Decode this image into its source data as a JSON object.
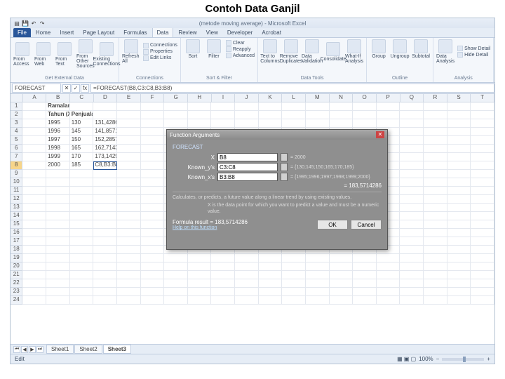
{
  "slide_title": "Contoh Data Ganjil",
  "window_title": "(metode moving average) - Microsoft Excel",
  "qat": {
    "save": "💾",
    "undo": "↶",
    "redo": "↷"
  },
  "tabs": [
    "File",
    "Home",
    "Insert",
    "Page Layout",
    "Formulas",
    "Data",
    "Review",
    "View",
    "Developer",
    "Acrobat"
  ],
  "active_tab": "Data",
  "ribbon": {
    "g1": {
      "items": [
        "From Access",
        "From Web",
        "From Text",
        "From Other Sources",
        "Existing Connections"
      ],
      "label": "Get External Data"
    },
    "g2": {
      "items": [
        "Refresh All"
      ],
      "sub": [
        "Connections",
        "Properties",
        "Edit Links"
      ],
      "label": "Connections"
    },
    "g3": {
      "items": [
        "Sort",
        "Filter"
      ],
      "sub": [
        "Clear",
        "Reapply",
        "Advanced"
      ],
      "label": "Sort & Filter"
    },
    "g4": {
      "items": [
        "Text to Columns",
        "Remove Duplicates",
        "Data Validation",
        "Consolidate",
        "What-If Analysis"
      ],
      "label": "Data Tools"
    },
    "g5": {
      "items": [
        "Group",
        "Ungroup",
        "Subtotal"
      ],
      "label": "Outline"
    },
    "g6": {
      "items": [
        "Data Analysis"
      ],
      "sub": [
        "Show Detail",
        "Hide Detail"
      ],
      "label": "Analysis"
    }
  },
  "namebox": "FORECAST",
  "fx": {
    "cancel": "✕",
    "ok": "✓",
    "fx": "fx"
  },
  "formula": "=FORECAST(B8,C3:C8,B3:B8)",
  "columns": [
    "A",
    "B",
    "C",
    "D",
    "E",
    "F",
    "G",
    "H",
    "I",
    "J",
    "K",
    "L",
    "M",
    "N",
    "O",
    "P",
    "Q",
    "R",
    "S",
    "T"
  ],
  "rows": [
    {
      "n": "1",
      "cells": [
        "",
        "Ramalan Penjualan Metode Least Square Data Genap",
        "",
        "",
        "",
        "",
        "",
        "",
        "",
        "",
        "",
        "",
        "",
        "",
        "",
        "",
        "",
        "",
        "",
        ""
      ]
    },
    {
      "n": "2",
      "cells": [
        "",
        "Tahun (X)",
        "Penjualan (Y)",
        "",
        "",
        "",
        "",
        "",
        "",
        "",
        "",
        "",
        "",
        "",
        "",
        "",
        "",
        "",
        "",
        ""
      ]
    },
    {
      "n": "3",
      "cells": [
        "",
        "1995",
        "130",
        "131,4286",
        "",
        "",
        "",
        "",
        "",
        "",
        "",
        "",
        "",
        "",
        "",
        "",
        "",
        "",
        "",
        ""
      ]
    },
    {
      "n": "4",
      "cells": [
        "",
        "1996",
        "145",
        "141,8571",
        "",
        "",
        "",
        "",
        "",
        "",
        "",
        "",
        "",
        "",
        "",
        "",
        "",
        "",
        "",
        ""
      ]
    },
    {
      "n": "5",
      "cells": [
        "",
        "1997",
        "150",
        "152,2857",
        "",
        "",
        "",
        "",
        "",
        "",
        "",
        "",
        "",
        "",
        "",
        "",
        "",
        "",
        "",
        ""
      ]
    },
    {
      "n": "6",
      "cells": [
        "",
        "1998",
        "165",
        "162,7143",
        "",
        "",
        "",
        "",
        "",
        "",
        "",
        "",
        "",
        "",
        "",
        "",
        "",
        "",
        "",
        ""
      ]
    },
    {
      "n": "7",
      "cells": [
        "",
        "1999",
        "170",
        "173,1429",
        "",
        "",
        "",
        "",
        "",
        "",
        "",
        "",
        "",
        "",
        "",
        "",
        "",
        "",
        "",
        ""
      ]
    },
    {
      "n": "8",
      "cells": [
        "",
        "2000",
        "185",
        "C8,B3:B8)",
        "",
        "",
        "",
        "",
        "",
        "",
        "",
        "",
        "",
        "",
        "",
        "",
        "",
        "",
        "",
        ""
      ]
    },
    {
      "n": "9",
      "cells": [
        "",
        "",
        "",
        "",
        "",
        "",
        "",
        "",
        "",
        "",
        "",
        "",
        "",
        "",
        "",
        "",
        "",
        "",
        "",
        ""
      ]
    },
    {
      "n": "10",
      "cells": [
        "",
        "",
        "",
        "",
        "",
        "",
        "",
        "",
        "",
        "",
        "",
        "",
        "",
        "",
        "",
        "",
        "",
        "",
        "",
        ""
      ]
    },
    {
      "n": "11",
      "cells": [
        "",
        "",
        "",
        "",
        "",
        "",
        "",
        "",
        "",
        "",
        "",
        "",
        "",
        "",
        "",
        "",
        "",
        "",
        "",
        ""
      ]
    },
    {
      "n": "12",
      "cells": [
        "",
        "",
        "",
        "",
        "",
        "",
        "",
        "",
        "",
        "",
        "",
        "",
        "",
        "",
        "",
        "",
        "",
        "",
        "",
        ""
      ]
    },
    {
      "n": "13",
      "cells": [
        "",
        "",
        "",
        "",
        "",
        "",
        "",
        "",
        "",
        "",
        "",
        "",
        "",
        "",
        "",
        "",
        "",
        "",
        "",
        ""
      ]
    },
    {
      "n": "14",
      "cells": [
        "",
        "",
        "",
        "",
        "",
        "",
        "",
        "",
        "",
        "",
        "",
        "",
        "",
        "",
        "",
        "",
        "",
        "",
        "",
        ""
      ]
    },
    {
      "n": "15",
      "cells": [
        "",
        "",
        "",
        "",
        "",
        "",
        "",
        "",
        "",
        "",
        "",
        "",
        "",
        "",
        "",
        "",
        "",
        "",
        "",
        ""
      ]
    },
    {
      "n": "16",
      "cells": [
        "",
        "",
        "",
        "",
        "",
        "",
        "",
        "",
        "",
        "",
        "",
        "",
        "",
        "",
        "",
        "",
        "",
        "",
        "",
        ""
      ]
    },
    {
      "n": "17",
      "cells": [
        "",
        "",
        "",
        "",
        "",
        "",
        "",
        "",
        "",
        "",
        "",
        "",
        "",
        "",
        "",
        "",
        "",
        "",
        "",
        ""
      ]
    },
    {
      "n": "18",
      "cells": [
        "",
        "",
        "",
        "",
        "",
        "",
        "",
        "",
        "",
        "",
        "",
        "",
        "",
        "",
        "",
        "",
        "",
        "",
        "",
        ""
      ]
    },
    {
      "n": "19",
      "cells": [
        "",
        "",
        "",
        "",
        "",
        "",
        "",
        "",
        "",
        "",
        "",
        "",
        "",
        "",
        "",
        "",
        "",
        "",
        "",
        ""
      ]
    },
    {
      "n": "20",
      "cells": [
        "",
        "",
        "",
        "",
        "",
        "",
        "",
        "",
        "",
        "",
        "",
        "",
        "",
        "",
        "",
        "",
        "",
        "",
        "",
        ""
      ]
    },
    {
      "n": "21",
      "cells": [
        "",
        "",
        "",
        "",
        "",
        "",
        "",
        "",
        "",
        "",
        "",
        "",
        "",
        "",
        "",
        "",
        "",
        "",
        "",
        ""
      ]
    },
    {
      "n": "22",
      "cells": [
        "",
        "",
        "",
        "",
        "",
        "",
        "",
        "",
        "",
        "",
        "",
        "",
        "",
        "",
        "",
        "",
        "",
        "",
        "",
        ""
      ]
    },
    {
      "n": "23",
      "cells": [
        "",
        "",
        "",
        "",
        "",
        "",
        "",
        "",
        "",
        "",
        "",
        "",
        "",
        "",
        "",
        "",
        "",
        "",
        "",
        ""
      ]
    },
    {
      "n": "24",
      "cells": [
        "",
        "",
        "",
        "",
        "",
        "",
        "",
        "",
        "",
        "",
        "",
        "",
        "",
        "",
        "",
        "",
        "",
        "",
        "",
        ""
      ]
    }
  ],
  "selected_row": "8",
  "dialog": {
    "title": "Function Arguments",
    "close": "✕",
    "fn": "FORECAST",
    "args": [
      {
        "label": "X",
        "value": "B8",
        "result": "= 2000"
      },
      {
        "label": "Known_y's",
        "value": "C3:C8",
        "result": "= {130;145;150;165;170;185}"
      },
      {
        "label": "Known_x's",
        "value": "B3:B8",
        "result": "= {1995;1996;1997;1998;1999;2000}"
      }
    ],
    "equals": "= 183,5714286",
    "desc1": "Calculates, or predicts, a future value along a linear trend by using existing values.",
    "desc2": "X is the data point for which you want to predict a value and must be a numeric value.",
    "formula_result_label": "Formula result =",
    "formula_result": "183,5714286",
    "help": "Help on this function",
    "ok": "OK",
    "cancel": "Cancel"
  },
  "sheets": {
    "nav": [
      "⏮",
      "◀",
      "▶",
      "⏭"
    ],
    "items": [
      "Sheet1",
      "Sheet2",
      "Sheet3"
    ],
    "active": "Sheet3"
  },
  "status": {
    "mode": "Edit",
    "zoom": "100%"
  }
}
